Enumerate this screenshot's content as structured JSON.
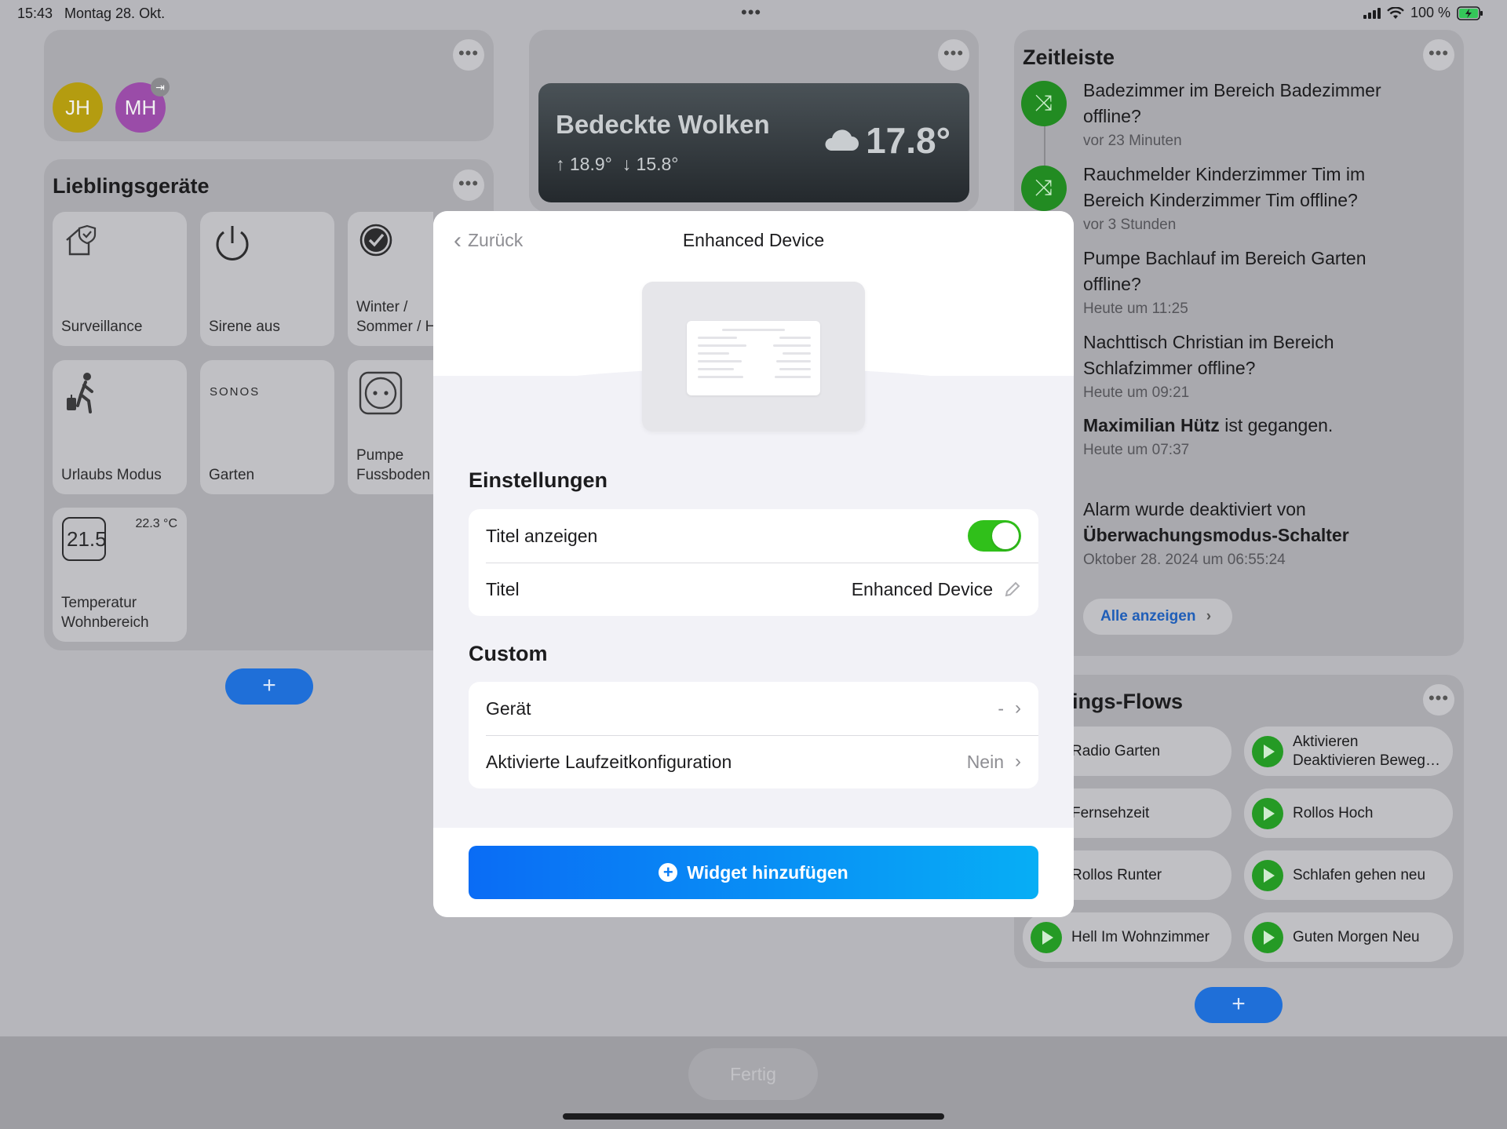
{
  "status": {
    "time": "15:43",
    "date": "Montag 28. Okt.",
    "battery": "100 %"
  },
  "users": [
    "JH",
    "MH"
  ],
  "favorites": {
    "title": "Lieblingsgeräte",
    "tiles": [
      {
        "label": "Surveillance",
        "icon": "home-shield-icon"
      },
      {
        "label": "Sirene aus",
        "icon": "power-icon"
      },
      {
        "label": "Winter /\nSommer / H",
        "icon": "check-circle-icon"
      },
      {
        "label": "Urlaubs Modus",
        "icon": "walking-person-icon"
      },
      {
        "label": "Garten",
        "icon": "sonos-logo",
        "brand": "SONOS"
      },
      {
        "label": "Pumpe\nFussboden",
        "icon": "socket-icon"
      },
      {
        "label": "Temperatur\nWohnbereich",
        "icon": "thermostat-icon",
        "display": "21.5",
        "reading": "22.3 °C"
      }
    ]
  },
  "weather": {
    "condition": "Bedeckte Wolken",
    "high": "18.9°",
    "low": "15.8°",
    "temp": "17.8°"
  },
  "timeline": {
    "title": "Zeitleiste",
    "items": [
      {
        "text": "Badezimmer im Bereich Badezimmer offline?",
        "time": "vor 23 Minuten"
      },
      {
        "text": "Rauchmelder Kinderzimmer Tim im Bereich Kinderzimmer Tim offline?",
        "time": "vor 3 Stunden"
      },
      {
        "text": "Pumpe Bachlauf im Bereich Garten offline?",
        "time": "Heute um 11:25"
      },
      {
        "text": "Nachttisch Christian  im Bereich Schlafzimmer offline?",
        "time": "Heute um 09:21"
      },
      {
        "bold": "Maximilian Hütz",
        "text": " ist gegangen.",
        "time": "Heute um 07:37"
      },
      {
        "text": "Alarm wurde deaktiviert von",
        "bold": "Überwachungsmodus-Schalter",
        "time": "Oktober 28. 2024 um 06:55:24"
      }
    ],
    "show_all": "Alle anzeigen"
  },
  "flows": {
    "title": "ings-Flows",
    "items": [
      "Radio Garten",
      "Aktivieren Deaktivieren Beweg…",
      "Fernsehzeit",
      "Rollos Hoch",
      "Rollos Runter",
      "Schlafen gehen neu",
      "Hell Im Wohnzimmer",
      "Guten Morgen Neu"
    ]
  },
  "done_label": "Fertig",
  "modal": {
    "back": "Zurück",
    "title": "Enhanced Device",
    "settings_title": "Einstellungen",
    "show_title_label": "Titel anzeigen",
    "show_title_on": true,
    "title_label": "Titel",
    "title_value": "Enhanced Device",
    "custom_title": "Custom",
    "device_label": "Gerät",
    "device_value": "-",
    "runtime_label": "Aktivierte Laufzeitkonfiguration",
    "runtime_value": "Nein",
    "add_button": "Widget hinzufügen"
  },
  "colors": {
    "accent": "#0a6cf5",
    "toggle_on": "#30c01a",
    "flow_play": "#259a25"
  }
}
